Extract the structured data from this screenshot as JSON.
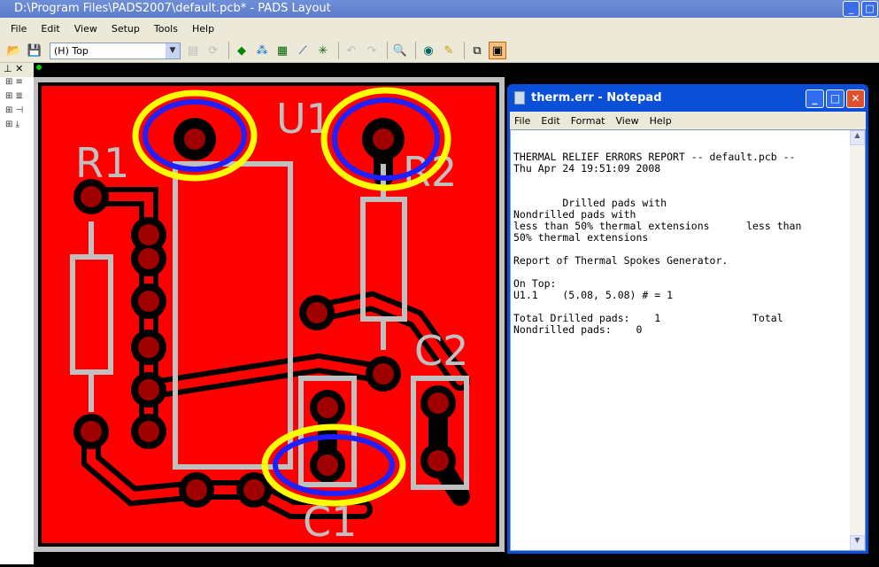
{
  "app": {
    "title": "D:\\Program Files\\PADS2007\\default.pcb* - PADS Layout"
  },
  "menu": [
    "File",
    "Edit",
    "View",
    "Setup",
    "Tools",
    "Help"
  ],
  "toolbar": {
    "layer_select": "(H) Top"
  },
  "pcb": {
    "labels": {
      "r1": "R1",
      "u1": "U1",
      "r2": "R2",
      "c1": "C1",
      "c2": "C2"
    },
    "colors": {
      "copper": "#ff0000",
      "silk": "#c0c0c0",
      "pad": "#a00000",
      "highlight_outer": "#ffff00",
      "highlight_inner": "#2020ff"
    }
  },
  "notepad": {
    "title": "therm.err - Notepad",
    "menu": [
      "File",
      "Edit",
      "Format",
      "View",
      "Help"
    ],
    "text": "THERMAL RELIEF ERRORS REPORT -- default.pcb --\nThu Apr 24 19:51:09 2008\n\n\n        Drilled pads with\nNondrilled pads with\nless than 50% thermal extensions      less than\n50% thermal extensions\n\nReport of Thermal Spokes Generator.\n\nOn Top:\nU1.1    (5.08, 5.08) # = 1\n\nTotal Drilled pads:    1               Total\nNondrilled pads:    0"
  }
}
